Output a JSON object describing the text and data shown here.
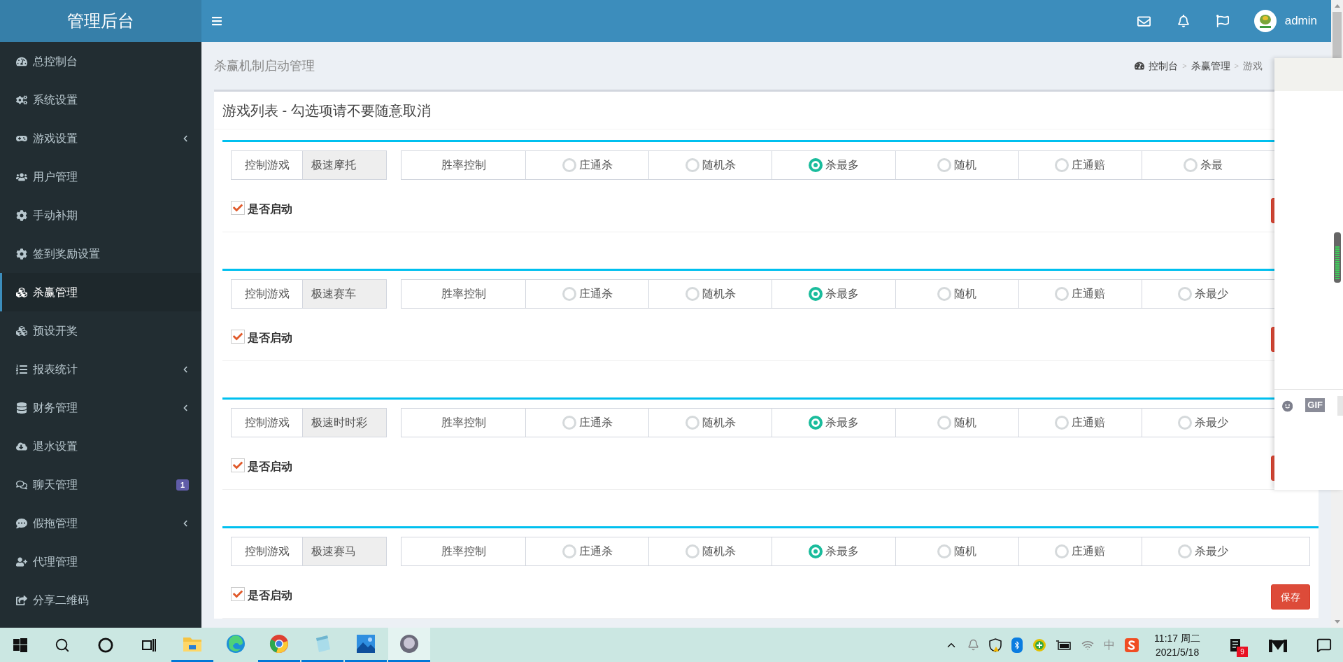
{
  "sidebar": {
    "title": "管理后台",
    "items": [
      {
        "label": "总控制台",
        "selected": false,
        "submenu": false
      },
      {
        "label": "系统设置",
        "selected": false,
        "submenu": false
      },
      {
        "label": "游戏设置",
        "selected": false,
        "submenu": true
      },
      {
        "label": "用户管理",
        "selected": false,
        "submenu": false
      },
      {
        "label": "手动补期",
        "selected": false,
        "submenu": false
      },
      {
        "label": "签到奖励设置",
        "selected": false,
        "submenu": false
      },
      {
        "label": "杀赢管理",
        "selected": true,
        "submenu": false
      },
      {
        "label": "预设开奖",
        "selected": false,
        "submenu": false
      },
      {
        "label": "报表统计",
        "selected": false,
        "submenu": true
      },
      {
        "label": "财务管理",
        "selected": false,
        "submenu": true
      },
      {
        "label": "退水设置",
        "selected": false,
        "submenu": false
      },
      {
        "label": "聊天管理",
        "selected": false,
        "submenu": false,
        "badge": "1"
      },
      {
        "label": "假拖管理",
        "selected": false,
        "submenu": true
      },
      {
        "label": "代理管理",
        "selected": false,
        "submenu": false
      },
      {
        "label": "分享二维码",
        "selected": false,
        "submenu": false
      }
    ]
  },
  "header": {
    "user": "admin"
  },
  "page": {
    "title": "杀赢机制启动管理",
    "breadcrumb": [
      "控制台",
      "杀赢管理",
      "游戏"
    ],
    "breadcrumb_separator": ">"
  },
  "box": {
    "title": "游戏列表 - 勾选项请不要随意取消",
    "cards": [
      {
        "addon": "控制游戏",
        "game": "极速摩托",
        "options_label": "胜率控制",
        "options": [
          {
            "label": "庄通杀",
            "selected": false
          },
          {
            "label": "随机杀",
            "selected": false
          },
          {
            "label": "杀最多",
            "selected": true
          },
          {
            "label": "随机",
            "selected": false
          },
          {
            "label": "庄通赔",
            "selected": false
          },
          {
            "label": "杀最",
            "selected": false
          }
        ],
        "enabled_label": "是否启动",
        "enabled": true
      },
      {
        "addon": "控制游戏",
        "game": "极速赛车",
        "options_label": "胜率控制",
        "options": [
          {
            "label": "庄通杀",
            "selected": false
          },
          {
            "label": "随机杀",
            "selected": false
          },
          {
            "label": "杀最多",
            "selected": true
          },
          {
            "label": "随机",
            "selected": false
          },
          {
            "label": "庄通赔",
            "selected": false
          },
          {
            "label": "杀最少",
            "selected": false
          }
        ],
        "enabled_label": "是否启动",
        "enabled": true
      },
      {
        "addon": "控制游戏",
        "game": "极速时时彩",
        "options_label": "胜率控制",
        "options": [
          {
            "label": "庄通杀",
            "selected": false
          },
          {
            "label": "随机杀",
            "selected": false
          },
          {
            "label": "杀最多",
            "selected": true
          },
          {
            "label": "随机",
            "selected": false
          },
          {
            "label": "庄通赔",
            "selected": false
          },
          {
            "label": "杀最少",
            "selected": false
          }
        ],
        "enabled_label": "是否启动",
        "enabled": true
      },
      {
        "addon": "控制游戏",
        "game": "极速赛马",
        "options_label": "胜率控制",
        "options": [
          {
            "label": "庄通杀",
            "selected": false
          },
          {
            "label": "随机杀",
            "selected": false
          },
          {
            "label": "杀最多",
            "selected": true
          },
          {
            "label": "随机",
            "selected": false
          },
          {
            "label": "庄通赔",
            "selected": false
          },
          {
            "label": "杀最少",
            "selected": false
          }
        ],
        "enabled_label": "是否启动",
        "enabled": true,
        "save_label": "保存"
      }
    ]
  },
  "side_panel": {
    "gif_label": "GIF"
  },
  "taskbar": {
    "apps": [
      {
        "kind": "folder",
        "running": true,
        "active": false
      },
      {
        "kind": "edge",
        "running": false,
        "active": false
      },
      {
        "kind": "chrome",
        "running": true,
        "active": false
      },
      {
        "kind": "notepad",
        "running": true,
        "active": false
      },
      {
        "kind": "photos",
        "running": true,
        "active": false
      },
      {
        "kind": "avatar",
        "running": true,
        "active": true
      }
    ],
    "ime": "中",
    "time": "11:17 周二",
    "date": "2021/5/18",
    "notifications": "9"
  }
}
